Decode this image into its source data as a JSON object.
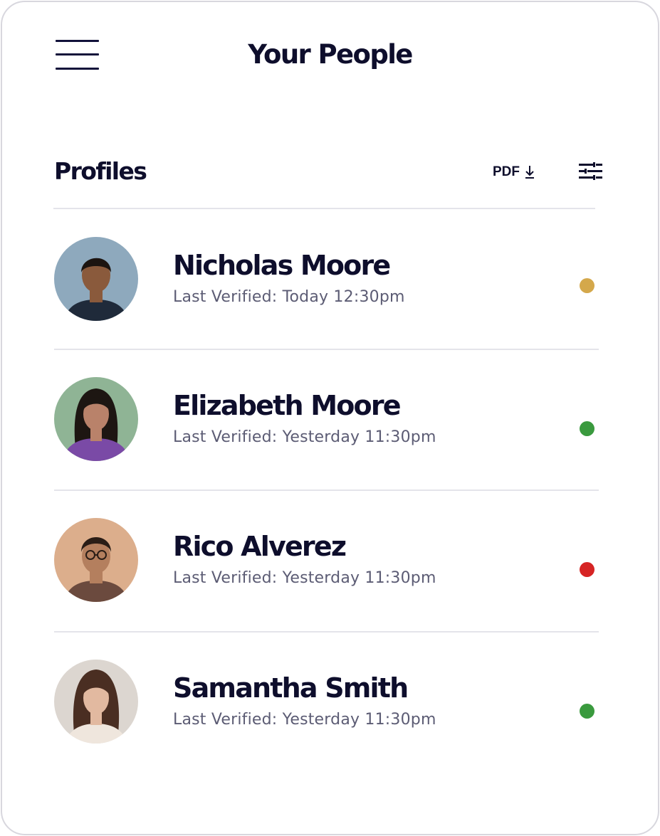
{
  "header": {
    "title": "Your People",
    "menu_icon": "hamburger-menu-icon"
  },
  "section": {
    "title": "Profiles",
    "pdf_label": "PDF",
    "pdf_icon": "download-icon",
    "filter_icon": "filter-settings-icon"
  },
  "people": [
    {
      "name": "Nicholas Moore",
      "meta": "Last Verified: Today 12:30pm",
      "status_color": "#d4a84b",
      "avatar_colors": {
        "bg": "#8ea9bd",
        "skin": "#8a5a3c",
        "hair": "#1c1410",
        "shirt": "#1f2a3a"
      }
    },
    {
      "name": "Elizabeth Moore",
      "meta": "Last Verified: Yesterday 11:30pm",
      "status_color": "#3a9a3e",
      "avatar_colors": {
        "bg": "#8fb495",
        "skin": "#b9826a",
        "hair": "#1d1612",
        "shirt": "#7a4aa6"
      }
    },
    {
      "name": "Rico Alverez",
      "meta": "Last Verified: Yesterday 11:30pm",
      "status_color": "#d62424",
      "avatar_colors": {
        "bg": "#dcae8c",
        "skin": "#b47f5e",
        "hair": "#2a1d16",
        "shirt": "#6b4a3e"
      }
    },
    {
      "name": "Samantha Smith",
      "meta": "Last Verified: Yesterday 11:30pm",
      "status_color": "#3a9a3e",
      "avatar_colors": {
        "bg": "#dcd6d0",
        "skin": "#e2b9a0",
        "hair": "#4a2e22",
        "shirt": "#efe6dd"
      }
    }
  ]
}
